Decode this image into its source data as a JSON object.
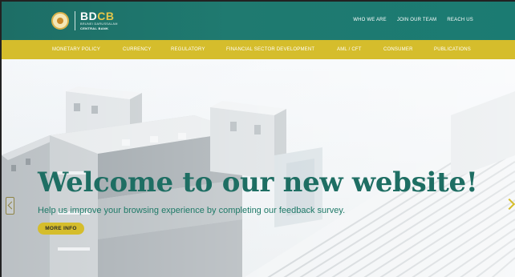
{
  "header": {
    "logo": {
      "mark_part1": "BD",
      "mark_part2": "CB",
      "subtitle": "BRUNEI DARUSSALAM",
      "name": "CENTRAL BANK"
    },
    "links": [
      "WHO WE ARE",
      "JOIN OUR TEAM",
      "REACH US"
    ]
  },
  "nav": {
    "items": [
      "MONETARY POLICY",
      "CURRENCY",
      "REGULATORY",
      "FINANCIAL SECTOR DEVELOPMENT",
      "AML / CFT",
      "CONSUMER",
      "PUBLICATIONS"
    ]
  },
  "hero": {
    "title": "Welcome to our new website!",
    "subtitle": "Help us improve your browsing experience by completing our feedback survey.",
    "button_label": "MORE INFO"
  },
  "colors": {
    "header_green": "#1f7a70",
    "nav_gold": "#d5bd2c",
    "title_green": "#1e6e63"
  }
}
